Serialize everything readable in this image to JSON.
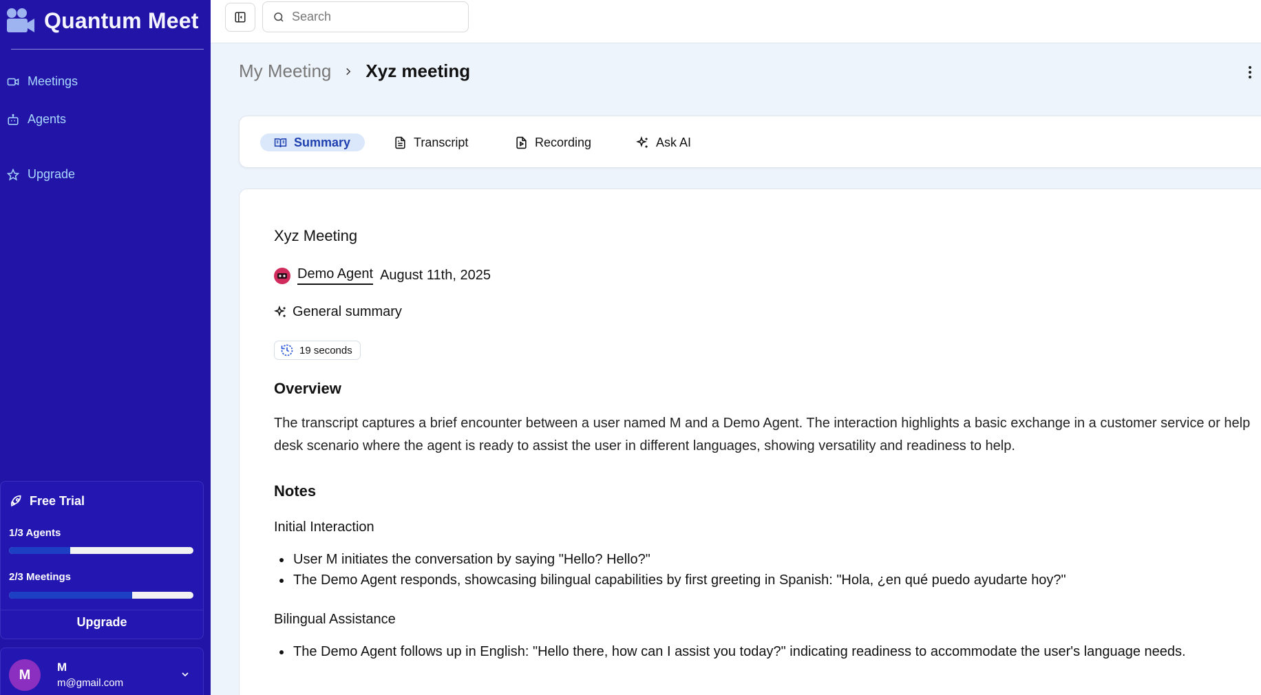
{
  "app": {
    "name": "Quantum Meet"
  },
  "sidebar": {
    "items": [
      {
        "label": "Meetings",
        "icon": "video-icon"
      },
      {
        "label": "Agents",
        "icon": "bot-icon"
      },
      {
        "label": "Upgrade",
        "icon": "star-icon"
      }
    ],
    "trial": {
      "title": "Free Trial",
      "agents_label": "1/3 Agents",
      "agents_progress": 0.333,
      "meetings_label": "2/3 Meetings",
      "meetings_progress": 0.667,
      "upgrade_label": "Upgrade"
    },
    "user": {
      "initial": "M",
      "name": "M",
      "email": "m@gmail.com"
    }
  },
  "header": {
    "search_placeholder": "Search"
  },
  "breadcrumb": {
    "parent": "My Meeting",
    "current": "Xyz meeting"
  },
  "tabs": [
    {
      "label": "Summary",
      "active": true
    },
    {
      "label": "Transcript",
      "active": false
    },
    {
      "label": "Recording",
      "active": false
    },
    {
      "label": "Ask AI",
      "active": false
    }
  ],
  "meeting": {
    "title": "Xyz Meeting",
    "agent": "Demo Agent",
    "date": "August 11th, 2025",
    "summary_label": "General summary",
    "duration": "19 seconds"
  },
  "summary": {
    "overview_heading": "Overview",
    "overview_text": "The transcript captures a brief encounter between a user named M and a Demo Agent. The interaction highlights a basic exchange in a customer service or help desk scenario where the agent is ready to assist the user in different languages, showing versatility and readiness to help.",
    "notes_heading": "Notes",
    "sections": [
      {
        "title": "Initial Interaction",
        "items": [
          "User M initiates the conversation by saying \"Hello? Hello?\"",
          "The Demo Agent responds, showcasing bilingual capabilities by first greeting in Spanish: \"Hola, ¿en qué puedo ayudarte hoy?\""
        ]
      },
      {
        "title": "Bilingual Assistance",
        "items": [
          "The Demo Agent follows up in English: \"Hello there, how can I assist you today?\" indicating readiness to accommodate the user's language needs."
        ]
      }
    ]
  },
  "colors": {
    "sidebar_bg": "#2214a6",
    "nav_link": "#a9d8ff",
    "active_tab_bg": "#dbe7fb",
    "active_tab_text": "#1e40af",
    "progress_fill": "#1c3fc4"
  }
}
